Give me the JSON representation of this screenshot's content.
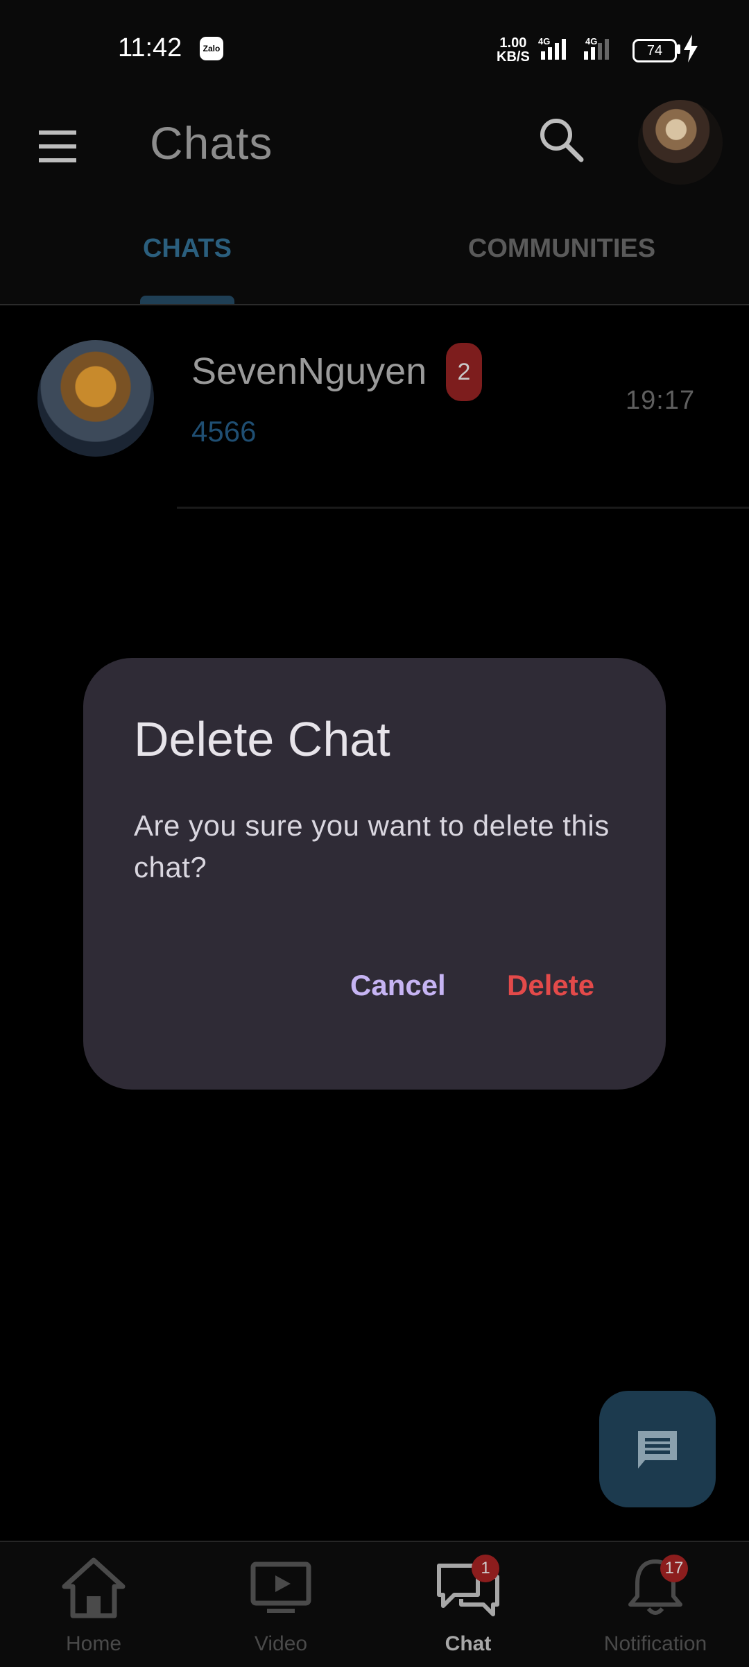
{
  "status_bar": {
    "time": "11:42",
    "app_icon_label": "Zalo",
    "net_speed_value": "1.00",
    "net_speed_unit": "KB/S",
    "signal_1": "4G",
    "signal_2": "4G",
    "battery": "74"
  },
  "app_bar": {
    "title": "Chats"
  },
  "tabs": [
    {
      "label": "CHATS",
      "active": true
    },
    {
      "label": "COMMUNITIES",
      "active": false
    }
  ],
  "chats": [
    {
      "name": "SevenNguyen",
      "unread": "2",
      "preview": "4566",
      "time": "19:17"
    }
  ],
  "dialog": {
    "title": "Delete Chat",
    "message": "Are you sure you want to delete this chat?",
    "cancel_label": "Cancel",
    "delete_label": "Delete"
  },
  "bottom_nav": [
    {
      "label": "Home",
      "icon": "home-icon",
      "badge": ""
    },
    {
      "label": "Video",
      "icon": "video-icon",
      "badge": ""
    },
    {
      "label": "Chat",
      "icon": "chat-icon",
      "badge": "1",
      "active": true
    },
    {
      "label": "Notification",
      "icon": "bell-icon",
      "badge": "17"
    }
  ],
  "colors": {
    "accent_blue": "#2b5f7e",
    "dialog_bg": "#2f2b36",
    "cancel": "#c6b4f3",
    "delete": "#e34a4a",
    "badge": "#8c1d1d"
  }
}
